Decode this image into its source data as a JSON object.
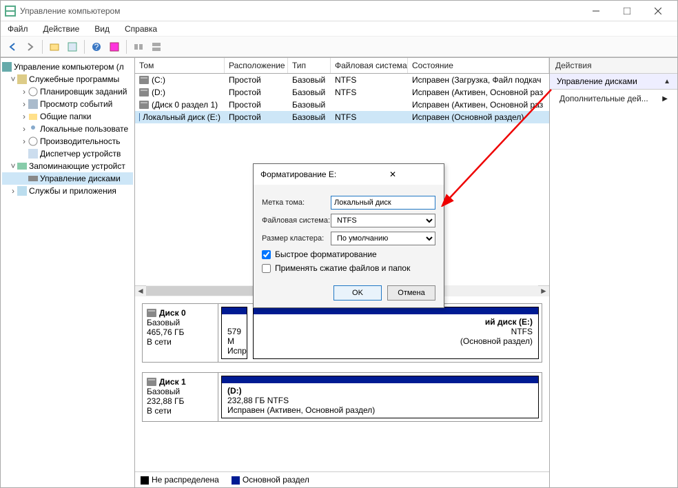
{
  "titlebar": {
    "title": "Управление компьютером"
  },
  "menubar": {
    "file": "Файл",
    "action": "Действие",
    "view": "Вид",
    "help": "Справка"
  },
  "tree": {
    "root": "Управление компьютером (л",
    "system_tools": "Служебные программы",
    "task_sched": "Планировщик заданий",
    "event_viewer": "Просмотр событий",
    "shared": "Общие папки",
    "local_users": "Локальные пользовате",
    "performance": "Производительность",
    "device_mgr": "Диспетчер устройств",
    "storage": "Запоминающие устройст",
    "disk_mgmt": "Управление дисками",
    "services": "Службы и приложения"
  },
  "table": {
    "headers": {
      "tom": "Том",
      "rasp": "Расположение",
      "tip": "Тип",
      "fs": "Файловая система",
      "state": "Состояние"
    },
    "rows": [
      {
        "tom": "(C:)",
        "rasp": "Простой",
        "tip": "Базовый",
        "fs": "NTFS",
        "state": "Исправен (Загрузка, Файл подкач"
      },
      {
        "tom": "(D:)",
        "rasp": "Простой",
        "tip": "Базовый",
        "fs": "NTFS",
        "state": "Исправен (Активен, Основной раз"
      },
      {
        "tom": "(Диск 0 раздел 1)",
        "rasp": "Простой",
        "tip": "Базовый",
        "fs": "",
        "state": "Исправен (Активен, Основной раз"
      },
      {
        "tom": "Локальный диск (E:)",
        "rasp": "Простой",
        "tip": "Базовый",
        "fs": "NTFS",
        "state": "Исправен (Основной раздел)"
      }
    ]
  },
  "actions": {
    "header": "Действия",
    "subheader": "Управление дисками",
    "link": "Дополнительные дей..."
  },
  "disk0": {
    "name": "Диск 0",
    "type": "Базовый",
    "size": "465,76 ГБ",
    "status": "В сети",
    "part1_size": "579 М",
    "part1_status": "Испр",
    "part2_name": "ий диск  (E:)",
    "part2_fs": "NTFS",
    "part2_status": "(Основной раздел)"
  },
  "disk1": {
    "name": "Диск 1",
    "type": "Базовый",
    "size": "232,88 ГБ",
    "status": "В сети",
    "part_name": "(D:)",
    "part_size": "232,88 ГБ NTFS",
    "part_status": "Исправен (Активен, Основной раздел)"
  },
  "legend": {
    "unalloc": "Не распределена",
    "primary": "Основной раздел"
  },
  "dialog": {
    "title": "Форматирование E:",
    "label_volume": "Метка тома:",
    "value_volume": "Локальный диск",
    "label_fs": "Файловая система:",
    "value_fs": "NTFS",
    "label_cluster": "Размер кластера:",
    "value_cluster": "По умолчанию",
    "quick_format": "Быстрое форматирование",
    "compress": "Применять сжатие файлов и папок",
    "ok": "OK",
    "cancel": "Отмена"
  }
}
